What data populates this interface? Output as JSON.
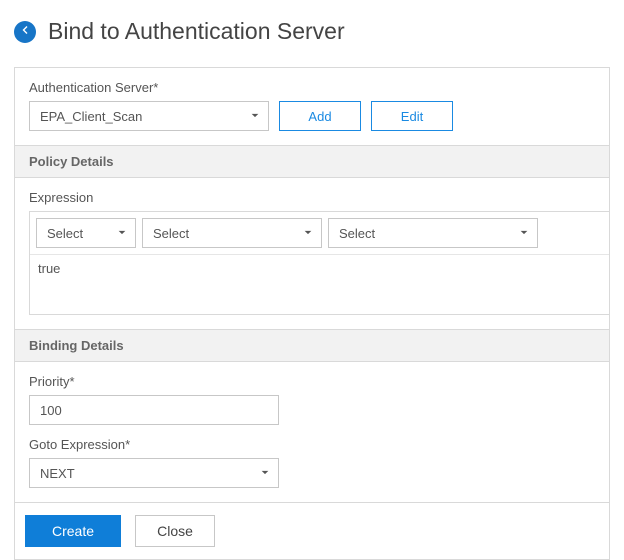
{
  "header": {
    "title": "Bind to Authentication Server"
  },
  "server": {
    "label": "Authentication Server*",
    "selected": "EPA_Client_Scan",
    "add_label": "Add",
    "edit_label": "Edit"
  },
  "policy": {
    "section_title": "Policy Details",
    "expression_label": "Expression",
    "sel1": "Select",
    "sel2": "Select",
    "sel3": "Select",
    "expression_value": "true"
  },
  "binding": {
    "section_title": "Binding Details",
    "priority_label": "Priority*",
    "priority_value": "100",
    "goto_label": "Goto Expression*",
    "goto_selected": "NEXT"
  },
  "footer": {
    "create_label": "Create",
    "close_label": "Close"
  }
}
